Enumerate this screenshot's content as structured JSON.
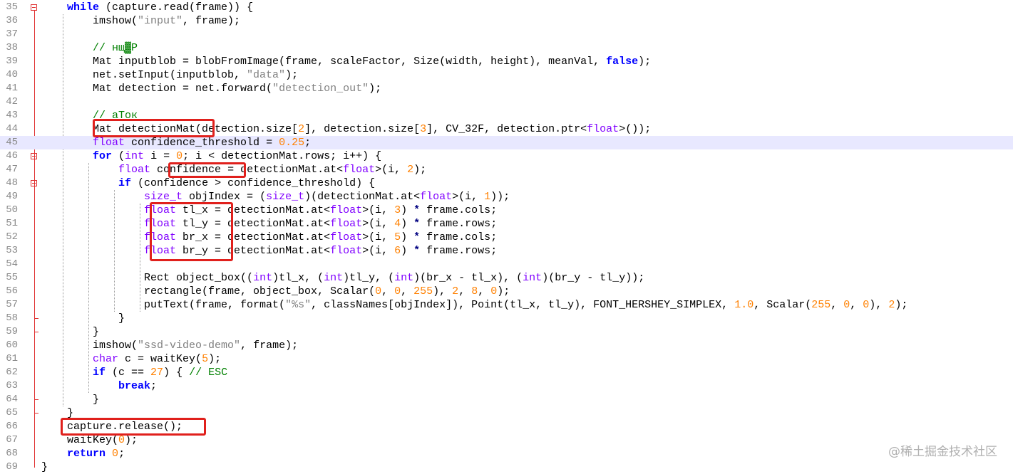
{
  "editor": {
    "current_line": 45,
    "lines": [
      {
        "n": "35",
        "tokens": [
          [
            "    ",
            ""
          ],
          [
            "while",
            "kw"
          ],
          [
            " (capture.read(frame)) {",
            ""
          ]
        ]
      },
      {
        "n": "36",
        "tokens": [
          [
            "        imshow(",
            ""
          ],
          [
            "\"input\"",
            "st"
          ],
          [
            ", frame);",
            ""
          ]
        ]
      },
      {
        "n": "37",
        "tokens": [
          [
            "",
            ""
          ]
        ]
      },
      {
        "n": "38",
        "tokens": [
          [
            "        ",
            ""
          ],
          [
            "// нщ▓Р",
            "cm"
          ]
        ]
      },
      {
        "n": "39",
        "tokens": [
          [
            "        Mat inputblob = blobFromImage(frame, scaleFactor, Size(width, height), meanVal, ",
            ""
          ],
          [
            "false",
            "kw"
          ],
          [
            ");",
            ""
          ]
        ]
      },
      {
        "n": "40",
        "tokens": [
          [
            "        net.setInput(inputblob, ",
            ""
          ],
          [
            "\"data\"",
            "st"
          ],
          [
            ");",
            ""
          ]
        ]
      },
      {
        "n": "41",
        "tokens": [
          [
            "        Mat detection = net.forward(",
            ""
          ],
          [
            "\"detection_out\"",
            "st"
          ],
          [
            ");",
            ""
          ]
        ]
      },
      {
        "n": "42",
        "tokens": [
          [
            "",
            ""
          ]
        ]
      },
      {
        "n": "43",
        "tokens": [
          [
            "        ",
            ""
          ],
          [
            "// аТок",
            "cm"
          ]
        ]
      },
      {
        "n": "44",
        "tokens": [
          [
            "        Mat detectionMat(detection.size[",
            ""
          ],
          [
            "2",
            "nm"
          ],
          [
            "], detection.size[",
            ""
          ],
          [
            "3",
            "nm"
          ],
          [
            "], CV_32F, detection.ptr<",
            ""
          ],
          [
            "float",
            "ty"
          ],
          [
            ">());",
            ""
          ]
        ]
      },
      {
        "n": "45",
        "tokens": [
          [
            "        ",
            ""
          ],
          [
            "float",
            "ty"
          ],
          [
            " confidence_threshold = ",
            ""
          ],
          [
            "0.25",
            "nm"
          ],
          [
            ";",
            ""
          ]
        ]
      },
      {
        "n": "46",
        "tokens": [
          [
            "        ",
            ""
          ],
          [
            "for",
            "kw"
          ],
          [
            " (",
            ""
          ],
          [
            "int",
            "ty"
          ],
          [
            " i = ",
            ""
          ],
          [
            "0",
            "nm"
          ],
          [
            "; i < detectionMat.rows; i++) {",
            ""
          ]
        ]
      },
      {
        "n": "47",
        "tokens": [
          [
            "            ",
            ""
          ],
          [
            "float",
            "ty"
          ],
          [
            " confidence = detectionMat.at<",
            ""
          ],
          [
            "float",
            "ty"
          ],
          [
            ">(i, ",
            ""
          ],
          [
            "2",
            "nm"
          ],
          [
            ");",
            ""
          ]
        ]
      },
      {
        "n": "48",
        "tokens": [
          [
            "            ",
            ""
          ],
          [
            "if",
            "kw"
          ],
          [
            " (confidence > confidence_threshold) {",
            ""
          ]
        ]
      },
      {
        "n": "49",
        "tokens": [
          [
            "                ",
            ""
          ],
          [
            "size_t",
            "ty"
          ],
          [
            " objIndex = (",
            ""
          ],
          [
            "size_t",
            "ty"
          ],
          [
            ")(detectionMat.at<",
            ""
          ],
          [
            "float",
            "ty"
          ],
          [
            ">(i, ",
            ""
          ],
          [
            "1",
            "nm"
          ],
          [
            "));",
            ""
          ]
        ]
      },
      {
        "n": "50",
        "tokens": [
          [
            "                ",
            ""
          ],
          [
            "float",
            "ty"
          ],
          [
            " tl_x = detectionMat.at<",
            ""
          ],
          [
            "float",
            "ty"
          ],
          [
            ">(i, ",
            ""
          ],
          [
            "3",
            "nm"
          ],
          [
            ") ",
            ""
          ],
          [
            "*",
            "op"
          ],
          [
            " frame.cols;",
            ""
          ]
        ]
      },
      {
        "n": "51",
        "tokens": [
          [
            "                ",
            ""
          ],
          [
            "float",
            "ty"
          ],
          [
            " tl_y = detectionMat.at<",
            ""
          ],
          [
            "float",
            "ty"
          ],
          [
            ">(i, ",
            ""
          ],
          [
            "4",
            "nm"
          ],
          [
            ") ",
            ""
          ],
          [
            "*",
            "op"
          ],
          [
            " frame.rows;",
            ""
          ]
        ]
      },
      {
        "n": "52",
        "tokens": [
          [
            "                ",
            ""
          ],
          [
            "float",
            "ty"
          ],
          [
            " br_x = detectionMat.at<",
            ""
          ],
          [
            "float",
            "ty"
          ],
          [
            ">(i, ",
            ""
          ],
          [
            "5",
            "nm"
          ],
          [
            ") ",
            ""
          ],
          [
            "*",
            "op"
          ],
          [
            " frame.cols;",
            ""
          ]
        ]
      },
      {
        "n": "53",
        "tokens": [
          [
            "                ",
            ""
          ],
          [
            "float",
            "ty"
          ],
          [
            " br_y = detectionMat.at<",
            ""
          ],
          [
            "float",
            "ty"
          ],
          [
            ">(i, ",
            ""
          ],
          [
            "6",
            "nm"
          ],
          [
            ") ",
            ""
          ],
          [
            "*",
            "op"
          ],
          [
            " frame.rows;",
            ""
          ]
        ]
      },
      {
        "n": "54",
        "tokens": [
          [
            "",
            ""
          ]
        ]
      },
      {
        "n": "55",
        "tokens": [
          [
            "                Rect object_box((",
            ""
          ],
          [
            "int",
            "ty"
          ],
          [
            ")tl_x, (",
            ""
          ],
          [
            "int",
            "ty"
          ],
          [
            ")tl_y, (",
            ""
          ],
          [
            "int",
            "ty"
          ],
          [
            ")(br_x - tl_x), (",
            ""
          ],
          [
            "int",
            "ty"
          ],
          [
            ")(br_y - tl_y));",
            ""
          ]
        ]
      },
      {
        "n": "56",
        "tokens": [
          [
            "                rectangle(frame, object_box, Scalar(",
            ""
          ],
          [
            "0",
            "nm"
          ],
          [
            ", ",
            ""
          ],
          [
            "0",
            "nm"
          ],
          [
            ", ",
            ""
          ],
          [
            "255",
            "nm"
          ],
          [
            "), ",
            ""
          ],
          [
            "2",
            "nm"
          ],
          [
            ", ",
            ""
          ],
          [
            "8",
            "nm"
          ],
          [
            ", ",
            ""
          ],
          [
            "0",
            "nm"
          ],
          [
            ");",
            ""
          ]
        ]
      },
      {
        "n": "57",
        "tokens": [
          [
            "                putText(frame, format(",
            ""
          ],
          [
            "\"%s\"",
            "st"
          ],
          [
            ", classNames[objIndex]), Point(tl_x, tl_y), FONT_HERSHEY_SIMPLEX, ",
            ""
          ],
          [
            "1.0",
            "nm"
          ],
          [
            ", Scalar(",
            ""
          ],
          [
            "255",
            "nm"
          ],
          [
            ", ",
            ""
          ],
          [
            "0",
            "nm"
          ],
          [
            ", ",
            ""
          ],
          [
            "0",
            "nm"
          ],
          [
            "), ",
            ""
          ],
          [
            "2",
            "nm"
          ],
          [
            ");",
            ""
          ]
        ]
      },
      {
        "n": "58",
        "tokens": [
          [
            "            }",
            ""
          ]
        ]
      },
      {
        "n": "59",
        "tokens": [
          [
            "        }",
            ""
          ]
        ]
      },
      {
        "n": "60",
        "tokens": [
          [
            "        imshow(",
            ""
          ],
          [
            "\"ssd-video-demo\"",
            "st"
          ],
          [
            ", frame);",
            ""
          ]
        ]
      },
      {
        "n": "61",
        "tokens": [
          [
            "        ",
            ""
          ],
          [
            "char",
            "ty"
          ],
          [
            " c = waitKey(",
            ""
          ],
          [
            "5",
            "nm"
          ],
          [
            ");",
            ""
          ]
        ]
      },
      {
        "n": "62",
        "tokens": [
          [
            "        ",
            ""
          ],
          [
            "if",
            "kw"
          ],
          [
            " (c == ",
            ""
          ],
          [
            "27",
            "nm"
          ],
          [
            ") { ",
            ""
          ],
          [
            "// ESC",
            "cm"
          ]
        ]
      },
      {
        "n": "63",
        "tokens": [
          [
            "            ",
            ""
          ],
          [
            "break",
            "kw"
          ],
          [
            ";",
            ""
          ]
        ]
      },
      {
        "n": "64",
        "tokens": [
          [
            "        }",
            ""
          ]
        ]
      },
      {
        "n": "65",
        "tokens": [
          [
            "    }",
            ""
          ]
        ]
      },
      {
        "n": "66",
        "tokens": [
          [
            "    capture.release();",
            ""
          ]
        ]
      },
      {
        "n": "67",
        "tokens": [
          [
            "    waitKey(",
            ""
          ],
          [
            "0",
            "nm"
          ],
          [
            ");",
            ""
          ]
        ]
      },
      {
        "n": "68",
        "tokens": [
          [
            "    ",
            ""
          ],
          [
            "return",
            "kw"
          ],
          [
            " ",
            ""
          ],
          [
            "0",
            "nm"
          ],
          [
            ";",
            ""
          ]
        ]
      },
      {
        "n": "69",
        "tokens": [
          [
            "}",
            ""
          ]
        ]
      }
    ]
  },
  "watermark": "@稀土掘金技术社区",
  "colors": {
    "keyword": "#0000ff",
    "type": "#8000ff",
    "string": "#808080",
    "number": "#ff8000",
    "comment": "#008000",
    "highlight_box": "#e0201c",
    "current_line": "#e8e8ff"
  }
}
